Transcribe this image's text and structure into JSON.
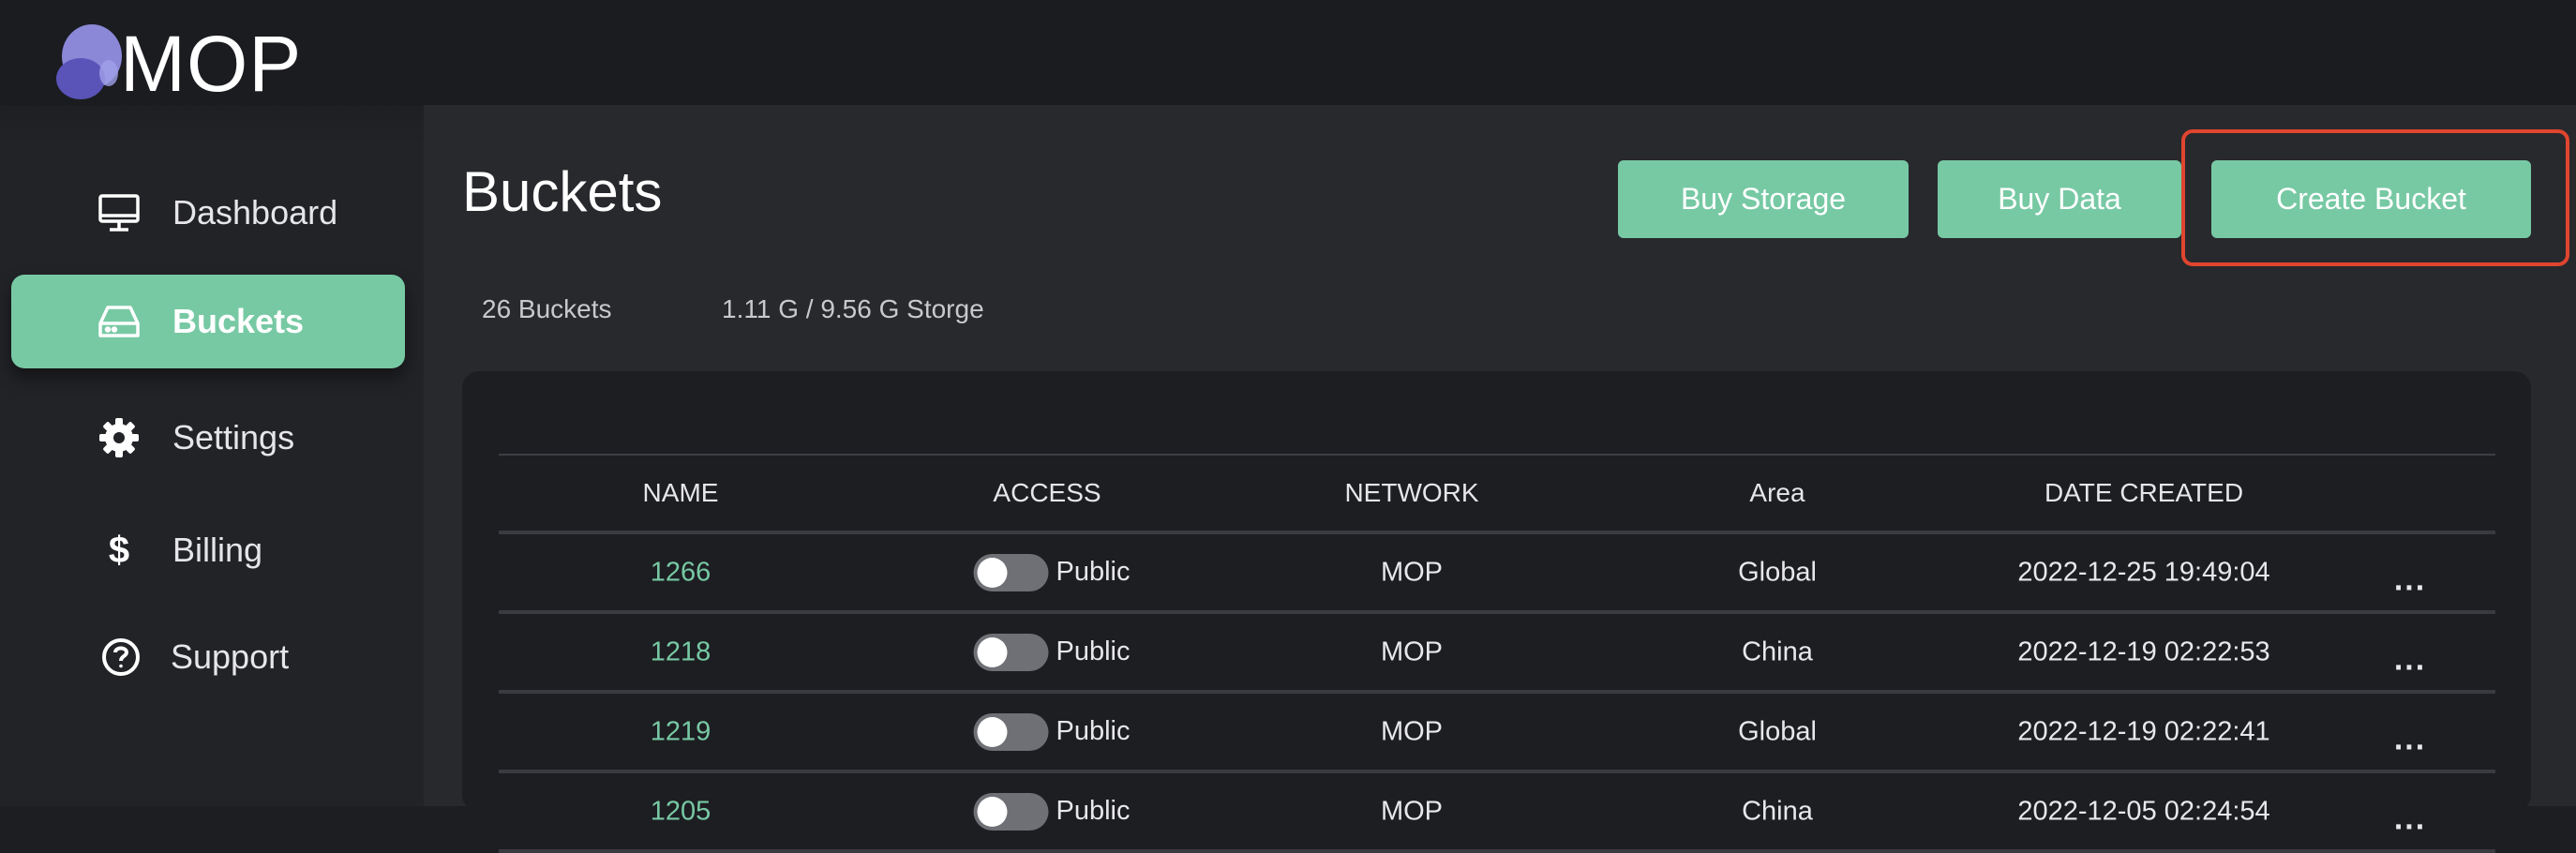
{
  "app": {
    "brand": "MOP"
  },
  "sidebar": {
    "items": [
      {
        "label": "Dashboard",
        "icon": "monitor-icon"
      },
      {
        "label": "Buckets",
        "icon": "drive-icon",
        "active": true
      },
      {
        "label": "Settings",
        "icon": "gear-icon"
      },
      {
        "label": "Billing",
        "icon": "dollar-icon",
        "symbol": "$"
      },
      {
        "label": "Support",
        "icon": "help-circle-icon"
      }
    ]
  },
  "main": {
    "title": "Buckets",
    "buttons": {
      "buy_storage": "Buy Storage",
      "buy_data": "Buy Data",
      "create_bucket": "Create Bucket"
    },
    "stats": {
      "bucket_count": "26 Buckets",
      "storage": "1.11 G / 9.56 G Storge"
    }
  },
  "table": {
    "headers": {
      "name": "NAME",
      "access": "ACCESS",
      "network": "NETWORK",
      "area": "Area",
      "date": "DATE CREATED"
    },
    "rows": [
      {
        "name": "1266",
        "access": "Public",
        "network": "MOP",
        "area": "Global",
        "date": "2022-12-25 19:49:04",
        "more": "..."
      },
      {
        "name": "1218",
        "access": "Public",
        "network": "MOP",
        "area": "China",
        "date": "2022-12-19 02:22:53",
        "more": "..."
      },
      {
        "name": "1219",
        "access": "Public",
        "network": "MOP",
        "area": "Global",
        "date": "2022-12-19 02:22:41",
        "more": "..."
      },
      {
        "name": "1205",
        "access": "Public",
        "network": "MOP",
        "area": "China",
        "date": "2022-12-05 02:24:54",
        "more": "..."
      }
    ]
  },
  "colors": {
    "accent": "#77c9a4",
    "highlight": "#e0452f",
    "background": "#1d1e22",
    "panel": "#28292d"
  }
}
